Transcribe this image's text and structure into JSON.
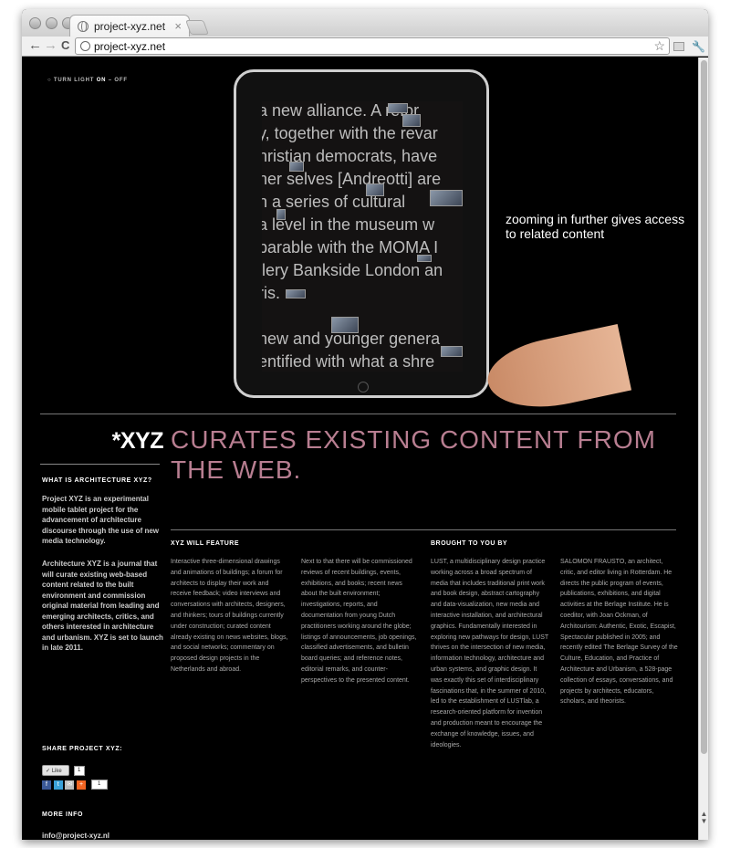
{
  "browser": {
    "tab_title": "project-xyz.net",
    "tab_close": "×",
    "url": "project-xyz.net",
    "back": "←",
    "forward": "→",
    "reload": "C",
    "star": "☆",
    "wrench": "🔧"
  },
  "page": {
    "light_toggle": {
      "prefix": "○ TURN LIGHT",
      "on": "ON",
      "separator": "–",
      "off": "OFF"
    },
    "ipad_screen_lines": [
      "a new alliance.  A refor",
      "y, together with the revar",
      "hristian democrats, have",
      "ner selves [Andreotti] are",
      "n a series of cultural",
      "a level in the museum w",
      "parable with the MOMA I",
      "llery Bankside London an",
      "ris.",
      "",
      "new and younger genera",
      "entified with what a shre"
    ],
    "zoom_caption": "zooming in further gives access to related content",
    "logo": "*XYZ",
    "headline": "CURATES EXISTING CONTENT FROM THE WEB.",
    "sidebar": {
      "what_heading": "WHAT IS ARCHITECTURE XYZ?",
      "what_p1": "Project XYZ is an experimental mobile tablet project for the advancement of architecture discourse through the use of new media technology.",
      "what_p2": "Architecture XYZ is a journal that will curate existing web-based content related to the built environment and commission original material from leading and emerging architects, critics, and others interested in architecture and urbanism. XYZ is set to launch in late 2011.",
      "share_heading": "SHARE PROJECT XYZ:",
      "like_label": "Like",
      "like_count": "1",
      "share_count": "1",
      "more_heading": "MORE INFO",
      "email": "info@project-xyz.nl"
    },
    "feature": {
      "heading": "XYZ WILL FEATURE",
      "col1": "Interactive three-dimensional drawings and animations of buildings; a forum for architects to display their work and receive feedback; video interviews and conversations with architects, designers, and thinkers; tours of buildings currently under construction; curated content already existing on news websites, blogs, and social networks; commentary on proposed design projects in the Netherlands and abroad.",
      "col2": "Next to that there will be commissioned reviews of recent buildings, events, exhibitions, and books; recent news about the built environment; investigations, reports, and documentation from young Dutch practitioners working around the globe; listings of announcements, job openings, classified advertisements, and bulletin board queries; and reference notes, editorial remarks, and counter-perspectives to the presented content."
    },
    "brought": {
      "heading": "BROUGHT TO YOU BY",
      "col1": "LUST, a multidisciplinary design practice working across a broad spectrum of media that includes traditional print work and book design, abstract cartography and data-visualization, new media and interactive installation, and architectural graphics. Fundamentally interested in exploring new pathways for design, LUST thrives on the intersection of new media, information technology, architecture and urban systems, and graphic design. It was exactly this set of interdisciplinary fascinations that, in the summer of 2010, led to the establishment of LUSTlab, a research-oriented platform for invention and production meant to encourage the exchange of knowledge, issues, and ideologies.",
      "col2": "SALOMON FRAUSTO, an architect, critic, and editor living in Rotterdam. He directs the public program of events, publications, exhibitions, and digital activities at the Berlage Institute. He is coeditor, with Joan Ockman, of Architourism: Authentic, Exotic, Escapist, Spectacular published in 2005; and recently edited The Berlage Survey of the Culture, Education, and Practice of Architecture and Urbanism, a 528-page collection of essays, conversations, and projects by architects, educators, scholars, and theorists."
    }
  }
}
